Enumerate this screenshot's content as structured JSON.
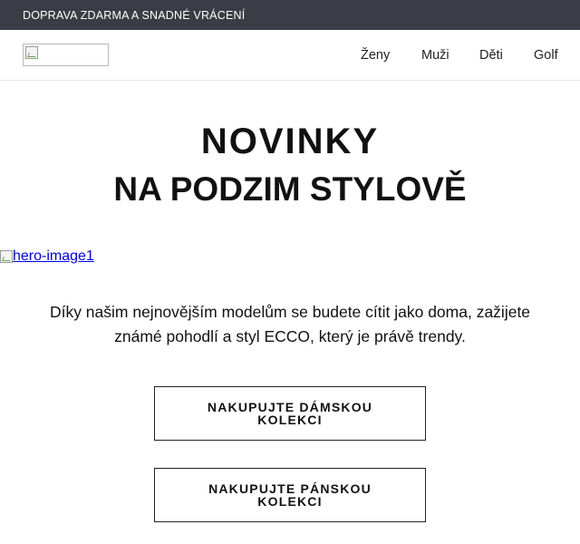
{
  "topbar": {
    "text": "DOPRAVA ZDARMA A SNADNÉ VRÁCENÍ"
  },
  "header": {
    "nav": [
      {
        "label": "Ženy"
      },
      {
        "label": "Muži"
      },
      {
        "label": "Děti"
      },
      {
        "label": "Golf"
      }
    ]
  },
  "main": {
    "title": "NOVINKY",
    "subtitle": "NA PODZIM STYLOVĚ",
    "hero_alt": "hero-image1",
    "description": "Díky našim nejnovějším modelům se budete cítit jako doma, zažijete známé pohodlí a styl ECCO, který je právě trendy.",
    "buttons": {
      "women": "NAKUPUJTE DÁMSKOU KOLEKCI",
      "men": "NAKUPUJTE PÁNSKOU KOLEKCI"
    }
  },
  "colors": {
    "topbar_bg": "#3c3c46",
    "topbar_text": "#ffffff",
    "link": "#0000ee"
  },
  "icons": {
    "logo": "broken-image-icon",
    "hero": "broken-image-icon"
  }
}
